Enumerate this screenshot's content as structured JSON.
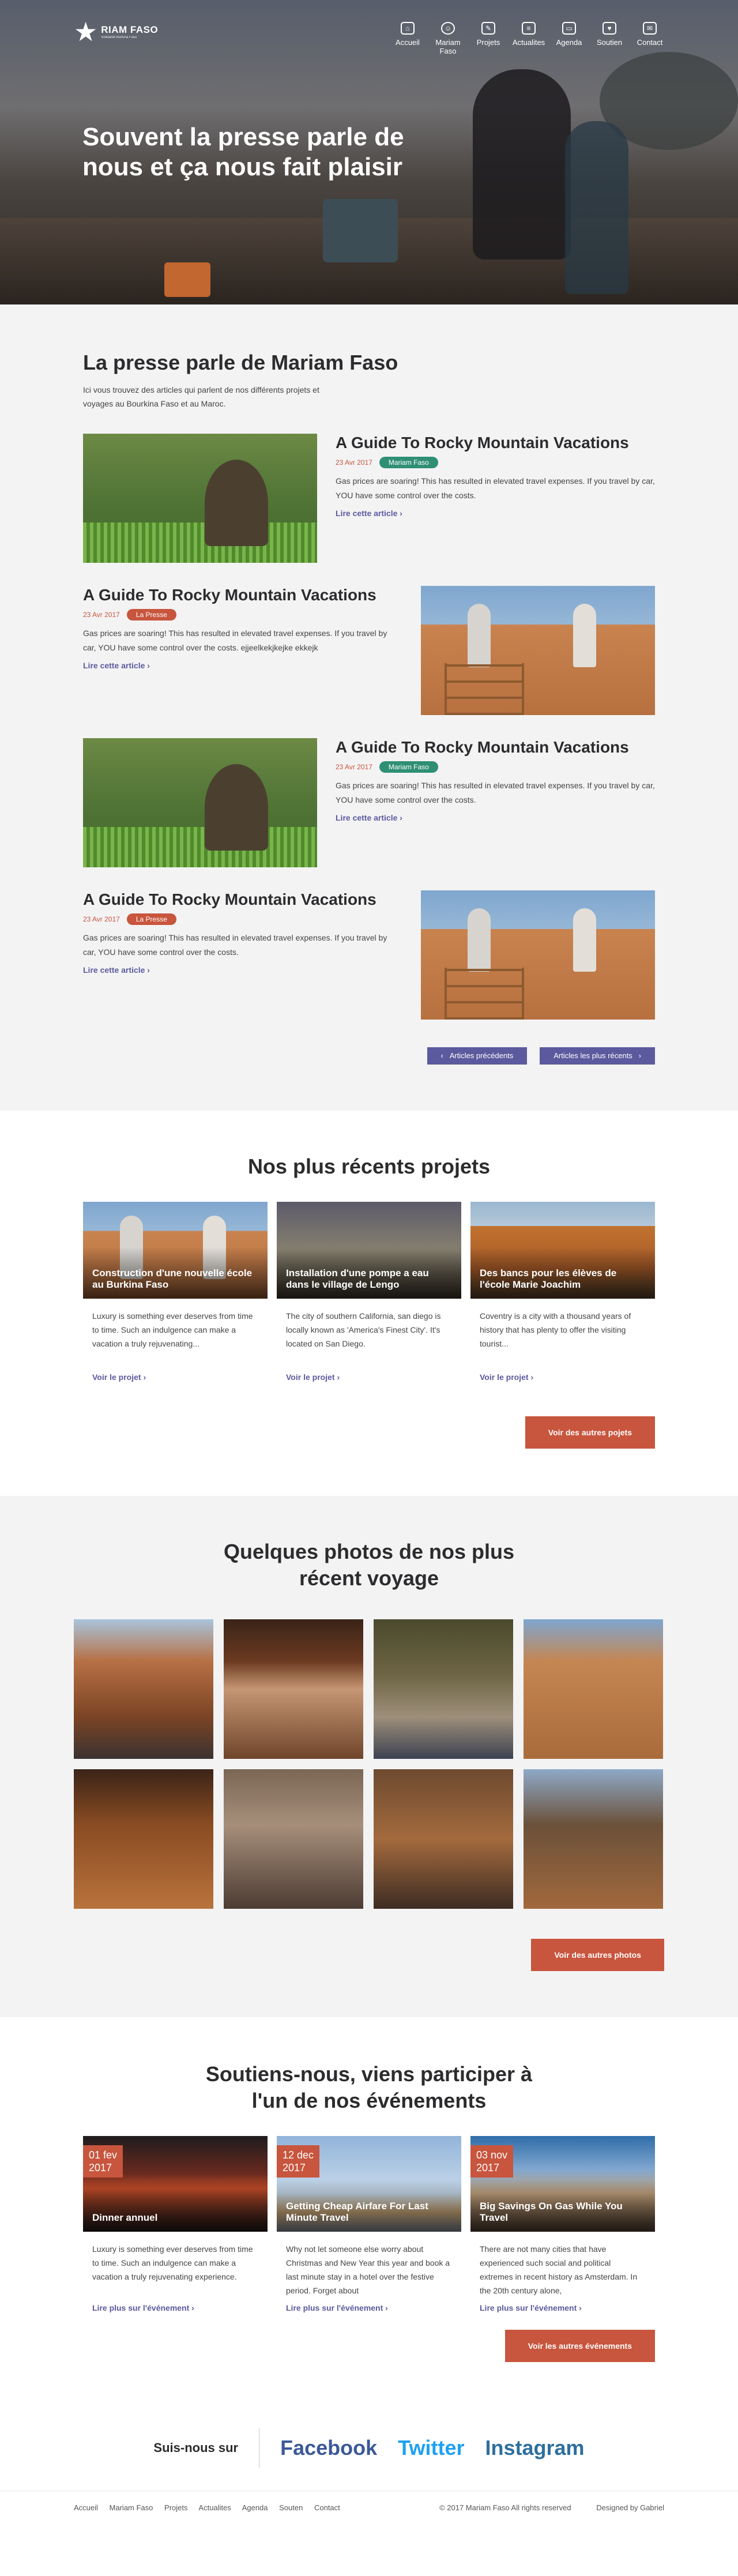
{
  "brand": {
    "name": "RIAM FASO",
    "tagline": "Solidarité Burkina Faso"
  },
  "nav": [
    {
      "label": "Accueil",
      "icon": "home-icon"
    },
    {
      "label": "Mariam Faso",
      "icon": "smile-icon"
    },
    {
      "label": "Projets",
      "icon": "pen-icon"
    },
    {
      "label": "Actualites",
      "icon": "document-icon"
    },
    {
      "label": "Agenda",
      "icon": "calendar-icon"
    },
    {
      "label": "Soutien",
      "icon": "bag-icon"
    },
    {
      "label": "Contact",
      "icon": "chat-icon"
    }
  ],
  "hero": {
    "title": "Souvent la presse parle de nous et ça nous fait plaisir"
  },
  "press": {
    "title": "La presse parle de Mariam Faso",
    "intro": "Ici vous trouvez des articles qui parlent de nos différents projets et voyages au Bourkina Faso et au Maroc.",
    "articles": [
      {
        "title": "A Guide To Rocky Mountain Vacations",
        "date": "23 Avr 2017",
        "badge": "Mariam Faso",
        "badge_color": "#2f8f74",
        "text": "Gas prices are soaring! This has resulted in elevated travel expenses. If you travel by car, YOU have some control over the costs.",
        "link": "Lire cette article"
      },
      {
        "title": "A Guide To Rocky Mountain Vacations",
        "date": "23 Avr 2017",
        "badge": "La Presse",
        "badge_color": "#c8553d",
        "text": "Gas prices are soaring! This has resulted in elevated travel expenses. If you travel by car, YOU have some control over the costs. ejjeelkekjkejke ekkejk",
        "link": "Lire cette article"
      },
      {
        "title": "A Guide To Rocky Mountain Vacations",
        "date": "23 Avr 2017",
        "badge": "Mariam Faso",
        "badge_color": "#2f8f74",
        "text": "Gas prices are soaring! This has resulted in elevated travel expenses. If you travel by car, YOU have some control over the costs.",
        "link": "Lire cette article"
      },
      {
        "title": "A Guide To Rocky Mountain Vacations",
        "date": "23 Avr 2017",
        "badge": "La Presse",
        "badge_color": "#c8553d",
        "text": "Gas prices are soaring! This has resulted in elevated travel expenses. If you travel by car, YOU have some control over the costs.",
        "link": "Lire cette article"
      }
    ],
    "prev_label": "Articles précédents",
    "next_label": "Articles les plus récents"
  },
  "projects": {
    "title": "Nos plus récents projets",
    "items": [
      {
        "caption": "Construction d'une nouvelle école au Burkina Faso",
        "text": "Luxury is something ever  deserves from time to time. Such an indulgence can make a vacation a truly rejuvenating...",
        "link": "Voir le projet"
      },
      {
        "caption": "Installation d'une pompe a eau dans  le village de Lengo",
        "text": "The city of southern California, san diego is locally known as 'America's Finest City'. It's located on San Diego.",
        "link": "Voir le projet"
      },
      {
        "caption": "Des bancs pour les élèves de l'école Marie Joachim",
        "text": "Coventry is a city with a thousand years of history that has plenty to offer the visiting tourist...",
        "link": "Voir le projet"
      }
    ],
    "button": "Voir des autres pojets"
  },
  "photos": {
    "title": "Quelques photos de nos plus récent voyage",
    "button": "Voir des autres photos"
  },
  "events": {
    "title": "Soutiens-nous, viens participer à l'un de nos événements",
    "items": [
      {
        "day": "01 fev",
        "year": "2017",
        "caption": "Dinner annuel",
        "text": "Luxury is something ever  deserves from time to time. Such an indulgence can make a vacation a truly rejuvenating experience.",
        "link": "Lire plus sur l'événement"
      },
      {
        "day": "12 dec",
        "year": "2017",
        "caption": "Getting Cheap Airfare For Last Minute Travel",
        "text": "Why not let someone else worry about Christmas and New Year this year and book a last minute stay in a hotel over the festive period. Forget about",
        "link": "Lire plus sur l'événement"
      },
      {
        "day": "03 nov",
        "year": "2017",
        "caption": "Big Savings On Gas While You Travel",
        "text": "There are not many cities that have experienced such social and political extremes in recent history as Amsterdam. In the 20th century alone,",
        "link": "Lire plus sur l'événement"
      }
    ],
    "button": "Voir les autres événements"
  },
  "social": {
    "label": "Suis-nous sur",
    "links": [
      {
        "label": "Facebook",
        "color": "#3b5998"
      },
      {
        "label": "Twitter",
        "color": "#1da1f2"
      },
      {
        "label": "Instagram",
        "color": "#2d6f9e"
      }
    ]
  },
  "footer": {
    "links": [
      "Accueil",
      "Mariam Faso",
      "Projets",
      "Actualites",
      "Agenda",
      "Souten",
      "Contact"
    ],
    "copyright": "© 2017 Mariam Faso All rights reserved",
    "credit": "Designed by Gabriel"
  }
}
